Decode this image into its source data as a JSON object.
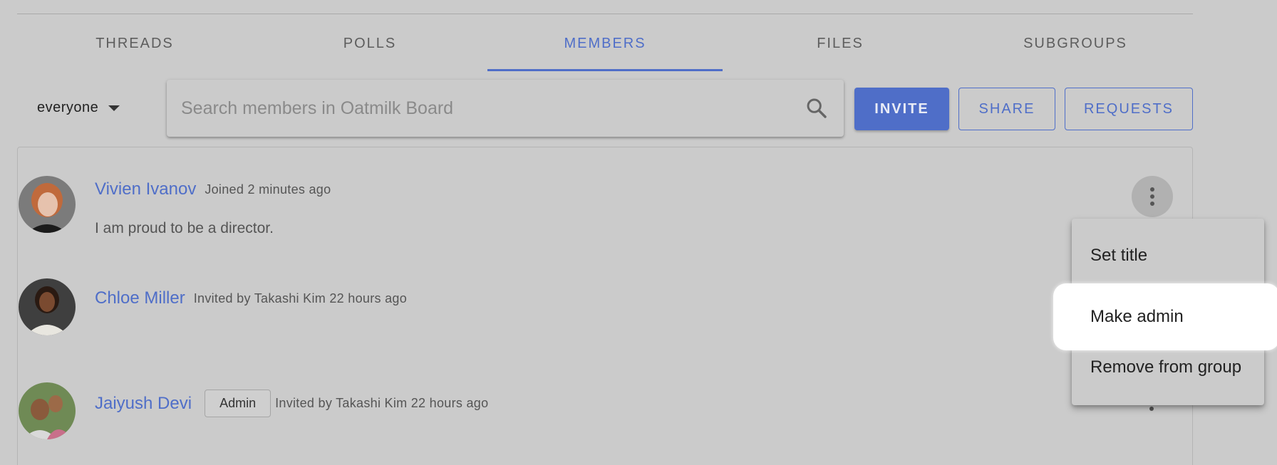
{
  "tabs": [
    "THREADS",
    "POLLS",
    "MEMBERS",
    "FILES",
    "SUBGROUPS"
  ],
  "active_tab": "MEMBERS",
  "toolbar": {
    "filter_label": "everyone",
    "search_placeholder": "Search members in Oatmilk Board",
    "invite_label": "INVITE",
    "share_label": "SHARE",
    "requests_label": "REQUESTS"
  },
  "members": [
    {
      "name": "Vivien Ivanov",
      "meta": "Joined 2 minutes ago",
      "bio": "I am proud to be a director."
    },
    {
      "name": "Chloe Miller",
      "meta": "Invited by Takashi Kim 22 hours ago"
    },
    {
      "name": "Jaiyush Devi",
      "badge": "Admin",
      "meta": "Invited by Takashi Kim 22 hours ago"
    }
  ],
  "context_menu": {
    "items": [
      "Set title",
      "Make admin",
      "Remove from group"
    ],
    "highlighted": "Make admin"
  },
  "colors": {
    "accent": "#4f6ec8",
    "background": "#cbcbcb",
    "highlight": "#ffffff"
  },
  "icons": [
    "search-icon",
    "caret-down-icon",
    "more-vert-icon"
  ]
}
